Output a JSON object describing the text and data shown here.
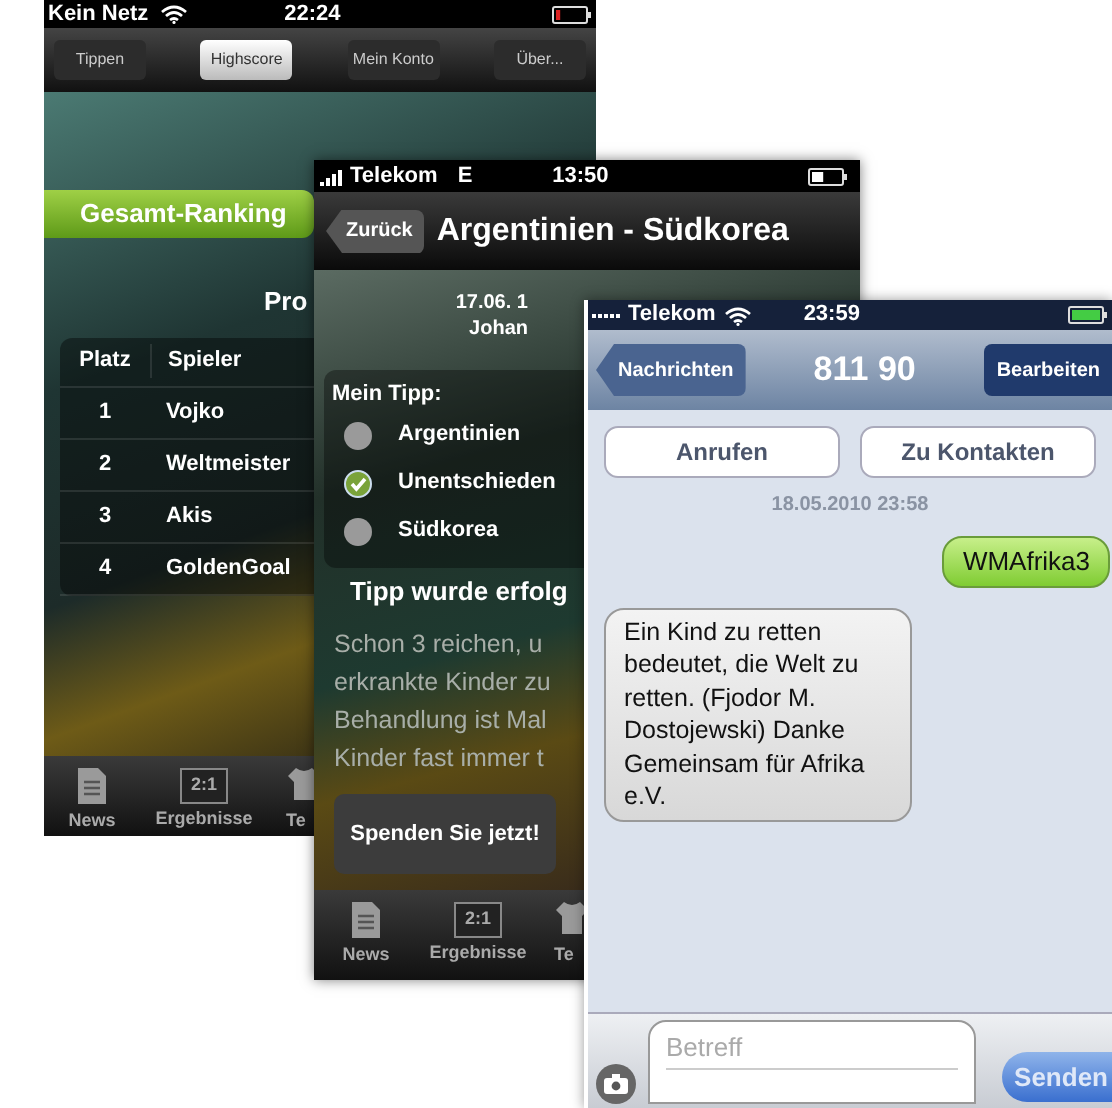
{
  "screens": [
    {
      "kind": "ranking",
      "status": {
        "carrier": "Kein Netz",
        "time": "22:24"
      },
      "segments": [
        {
          "label": "Tippen",
          "selected": false
        },
        {
          "label": "Highscore",
          "selected": true
        },
        {
          "label": "Mein Konto",
          "selected": false
        },
        {
          "label": "Über...",
          "selected": false
        }
      ],
      "ranking_button": "Gesamt-Ranking",
      "heading": "Pro",
      "table": {
        "columns": [
          "Platz",
          "Spieler"
        ],
        "rows": [
          [
            "1",
            "Vojko"
          ],
          [
            "2",
            "Weltmeister"
          ],
          [
            "3",
            "Akis"
          ],
          [
            "4",
            "GoldenGoal"
          ]
        ]
      },
      "tabbar": [
        {
          "kind": "news",
          "label": "News"
        },
        {
          "kind": "score",
          "label": "Ergebnisse",
          "icon_text": "2:1"
        },
        {
          "kind": "shirt",
          "label": "Te"
        }
      ]
    },
    {
      "kind": "match",
      "status": {
        "carrier": "Telekom",
        "network": "E",
        "time": "13:50"
      },
      "back_button": "Zurück",
      "title": "Argentinien - Südkorea",
      "date": "17.06. 1",
      "venue": "Johan",
      "tip_label": "Mein Tipp:",
      "options": [
        {
          "label": "Argentinien",
          "selected": false
        },
        {
          "label": "Unentschieden",
          "selected": true
        },
        {
          "label": "Südkorea",
          "selected": false
        }
      ],
      "confirmation": "Tipp wurde erfolg",
      "message_lines": [
        "Schon 3 reichen, u",
        "erkrankte Kinder zu",
        "Behandlung ist Mal",
        "Kinder fast immer t"
      ],
      "donate_button": "Spenden Sie jetzt!",
      "tabbar": [
        {
          "kind": "news",
          "label": "News"
        },
        {
          "kind": "score",
          "label": "Ergebnisse",
          "icon_text": "2:1"
        },
        {
          "kind": "shirt",
          "label": "Te"
        }
      ]
    },
    {
      "kind": "sms",
      "status": {
        "carrier": "Telekom",
        "time": "23:59"
      },
      "back_button": "Nachrichten",
      "title": "811 90",
      "edit_button": "Bearbeiten",
      "actions": [
        "Anrufen",
        "Zu Kontakten"
      ],
      "timestamp": "18.05.2010 23:58",
      "messages": [
        {
          "kind": "sent",
          "text": "WMAfrika3"
        },
        {
          "kind": "received",
          "text": "Ein Kind zu retten bedeutet, die Welt zu retten. (Fjodor M. Dostojewski) Danke Gemeinsam für Afrika e.V."
        }
      ],
      "compose": {
        "placeholder": "Betreff"
      },
      "send_button": "Senden"
    }
  ]
}
